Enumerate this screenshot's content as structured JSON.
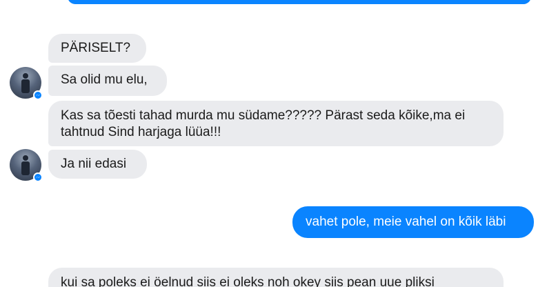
{
  "conversation": {
    "messages": [
      {
        "sender": "contact",
        "text": "PÄRISELT?"
      },
      {
        "sender": "contact",
        "text": "Sa olid mu elu,"
      },
      {
        "sender": "contact",
        "text": "Kas sa tõesti tahad murda mu südame????? Pärast seda kõike,ma ei tahtnud Sind harjaga lüüa!!!"
      },
      {
        "sender": "contact",
        "text": "Ja nii edasi"
      },
      {
        "sender": "me",
        "text": "vahet pole, meie vahel on kõik läbi"
      },
      {
        "sender": "contact",
        "text": "kui sa poleks ei öelnud siis ei oleks noh okey siis pean uue pliksi"
      }
    ]
  },
  "colors": {
    "incoming_bubble": "#eaebee",
    "outgoing_bubble": "#0a84ff",
    "background": "#ffffff",
    "messenger_badge": "#0a84ff"
  },
  "icons": {
    "avatar": "contact-avatar",
    "badge": "messenger-badge-icon"
  }
}
